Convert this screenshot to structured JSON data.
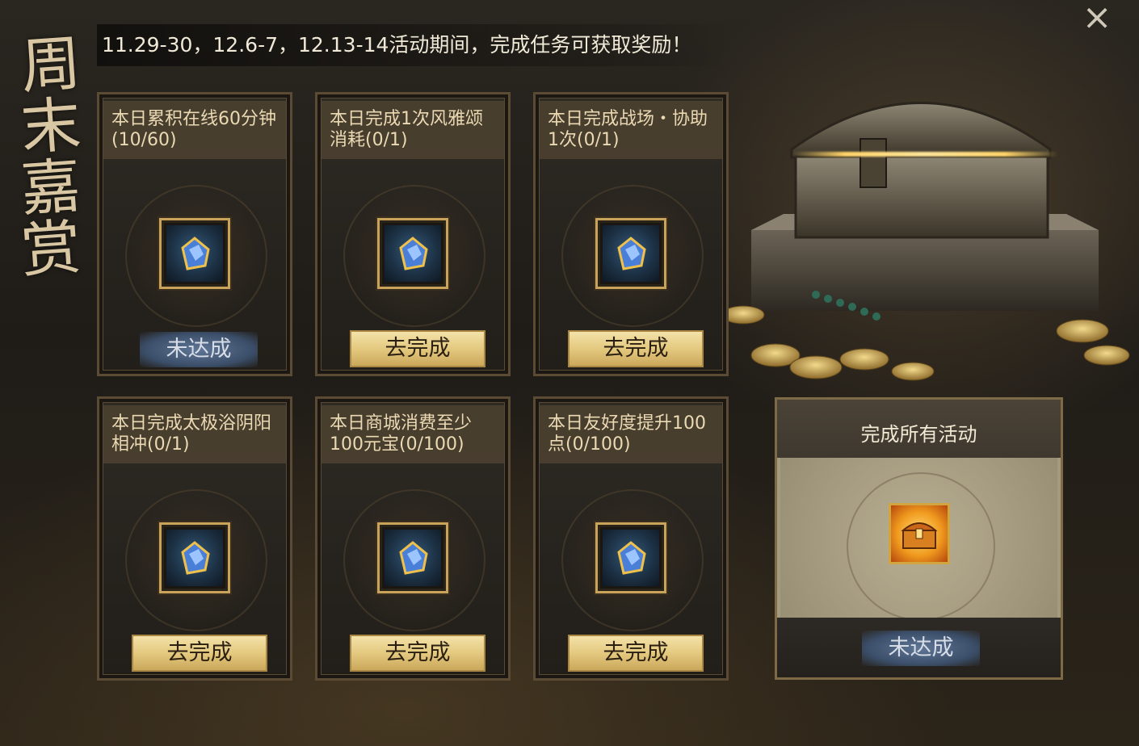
{
  "window": {
    "title_vertical": [
      "周",
      "末",
      "嘉",
      "赏"
    ],
    "banner": "11.29-30，12.6-7，12.13-14活动期间，完成任务可获取奖励！",
    "close_icon": "×"
  },
  "tasks": [
    {
      "desc": "本日累积在线60分钟(10/60)",
      "reward_icon": "blue-gem-icon",
      "action": "未达成",
      "state": "undone"
    },
    {
      "desc": "本日完成1次风雅颂消耗(0/1)",
      "reward_icon": "blue-gem-icon",
      "action": "去完成",
      "state": "go"
    },
    {
      "desc": "本日完成战场・协助1次(0/1)",
      "reward_icon": "blue-gem-icon",
      "action": "去完成",
      "state": "go"
    },
    {
      "desc": "本日完成太极浴阴阳相冲(0/1)",
      "reward_icon": "blue-gem-icon",
      "action": "去完成",
      "state": "go"
    },
    {
      "desc": "本日商城消费至少100元宝(0/100)",
      "reward_icon": "blue-gem-icon",
      "action": "去完成",
      "state": "go"
    },
    {
      "desc": "本日友好度提升100点(0/100)",
      "reward_icon": "blue-gem-icon",
      "action": "去完成",
      "state": "go"
    }
  ],
  "final": {
    "title": "完成所有活动",
    "reward_icon": "golden-chest-icon",
    "action": "未达成"
  },
  "colors": {
    "accent_gold": "#e4c97f",
    "undone_blue": "#3b4e69",
    "text_cream": "#ead9b3"
  }
}
